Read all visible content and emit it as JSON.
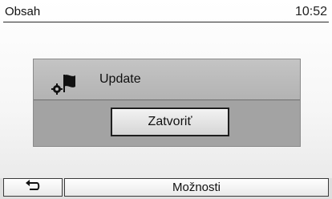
{
  "header": {
    "title": "Obsah",
    "clock": "10:52"
  },
  "dialog": {
    "icon": "flag-with-gear-icon",
    "message": "Update",
    "close_label": "Zatvoriť"
  },
  "footer": {
    "back_icon": "back-arrow-icon",
    "options_label": "Možnosti"
  }
}
